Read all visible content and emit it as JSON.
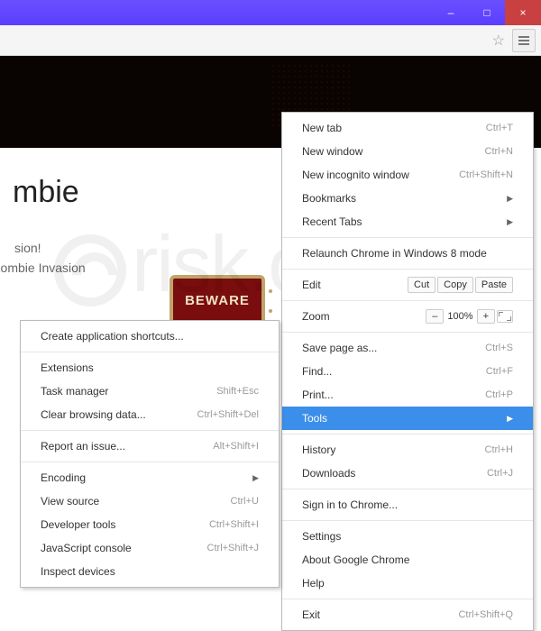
{
  "titlebar": {
    "min": "–",
    "max": "□",
    "close": "×"
  },
  "page": {
    "title": "mbie",
    "sub1": "sion!",
    "sub2": "Zombie Invasion",
    "beware": "BEWARE",
    "watermark": "risk.com"
  },
  "mainMenu": [
    {
      "t": "item",
      "label": "New tab",
      "shortcut": "Ctrl+T"
    },
    {
      "t": "item",
      "label": "New window",
      "shortcut": "Ctrl+N"
    },
    {
      "t": "item",
      "label": "New incognito window",
      "shortcut": "Ctrl+Shift+N"
    },
    {
      "t": "sub",
      "label": "Bookmarks"
    },
    {
      "t": "sub",
      "label": "Recent Tabs"
    },
    {
      "t": "sep"
    },
    {
      "t": "item",
      "label": "Relaunch Chrome in Windows 8 mode"
    },
    {
      "t": "sep"
    },
    {
      "t": "edit",
      "label": "Edit",
      "buttons": [
        "Cut",
        "Copy",
        "Paste"
      ]
    },
    {
      "t": "sep"
    },
    {
      "t": "zoom",
      "label": "Zoom",
      "value": "100%"
    },
    {
      "t": "sep"
    },
    {
      "t": "item",
      "label": "Save page as...",
      "shortcut": "Ctrl+S"
    },
    {
      "t": "item",
      "label": "Find...",
      "shortcut": "Ctrl+F"
    },
    {
      "t": "item",
      "label": "Print...",
      "shortcut": "Ctrl+P"
    },
    {
      "t": "hl",
      "label": "Tools"
    },
    {
      "t": "sep"
    },
    {
      "t": "item",
      "label": "History",
      "shortcut": "Ctrl+H"
    },
    {
      "t": "item",
      "label": "Downloads",
      "shortcut": "Ctrl+J"
    },
    {
      "t": "sep"
    },
    {
      "t": "item",
      "label": "Sign in to Chrome..."
    },
    {
      "t": "sep"
    },
    {
      "t": "item",
      "label": "Settings"
    },
    {
      "t": "item",
      "label": "About Google Chrome"
    },
    {
      "t": "item",
      "label": "Help"
    },
    {
      "t": "sep"
    },
    {
      "t": "item",
      "label": "Exit",
      "shortcut": "Ctrl+Shift+Q"
    }
  ],
  "subMenu": [
    {
      "t": "item",
      "label": "Create application shortcuts..."
    },
    {
      "t": "sep"
    },
    {
      "t": "item",
      "label": "Extensions"
    },
    {
      "t": "item",
      "label": "Task manager",
      "shortcut": "Shift+Esc"
    },
    {
      "t": "item",
      "label": "Clear browsing data...",
      "shortcut": "Ctrl+Shift+Del"
    },
    {
      "t": "sep"
    },
    {
      "t": "item",
      "label": "Report an issue...",
      "shortcut": "Alt+Shift+I"
    },
    {
      "t": "sep"
    },
    {
      "t": "sub",
      "label": "Encoding"
    },
    {
      "t": "item",
      "label": "View source",
      "shortcut": "Ctrl+U"
    },
    {
      "t": "item",
      "label": "Developer tools",
      "shortcut": "Ctrl+Shift+I"
    },
    {
      "t": "item",
      "label": "JavaScript console",
      "shortcut": "Ctrl+Shift+J"
    },
    {
      "t": "item",
      "label": "Inspect devices"
    }
  ]
}
